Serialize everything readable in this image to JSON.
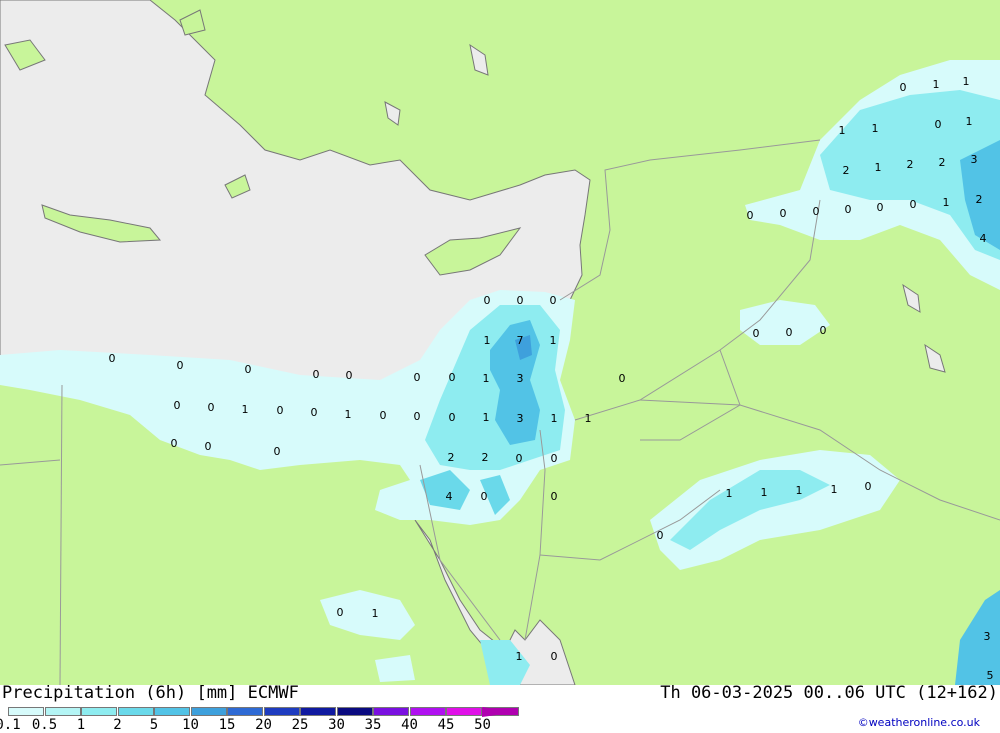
{
  "title": "Precipitation (6h) [mm] ECMWF",
  "valid_time": "Th 06-03-2025 00..06 UTC (12+162)",
  "credit": "©weatheronline.co.uk",
  "colors": {
    "land": "#c8f59a",
    "sea": "#ececec",
    "border": "#999999",
    "coast": "#777777"
  },
  "legend": {
    "labels": [
      "0.1",
      "0.5",
      "1",
      "2",
      "5",
      "10",
      "15",
      "20",
      "25",
      "30",
      "35",
      "40",
      "45",
      "50"
    ],
    "colors": [
      "#d7fbfb",
      "#b4f5f5",
      "#8eecf0",
      "#6ad9ea",
      "#52c3e6",
      "#3ea0dc",
      "#2e6ad4",
      "#1e3cc0",
      "#101aa0",
      "#0a0a80",
      "#7a10e0",
      "#b010f0",
      "#e010e8",
      "#b000b0"
    ]
  },
  "values": [
    {
      "text": "0"
    },
    {
      "text": "0"
    },
    {
      "text": "0"
    },
    {
      "text": "1"
    },
    {
      "text": "7"
    },
    {
      "text": "1"
    },
    {
      "text": "0"
    },
    {
      "text": "0"
    },
    {
      "text": "0"
    },
    {
      "text": "0"
    },
    {
      "text": "0"
    },
    {
      "text": "0"
    },
    {
      "text": "0"
    },
    {
      "text": "1"
    },
    {
      "text": "3"
    },
    {
      "text": "0"
    },
    {
      "text": "0"
    },
    {
      "text": "0"
    },
    {
      "text": "1"
    },
    {
      "text": "0"
    },
    {
      "text": "0"
    },
    {
      "text": "1"
    },
    {
      "text": "0"
    },
    {
      "text": "0"
    },
    {
      "text": "0"
    },
    {
      "text": "1"
    },
    {
      "text": "3"
    },
    {
      "text": "1"
    },
    {
      "text": "1"
    },
    {
      "text": "0"
    },
    {
      "text": "0"
    },
    {
      "text": "0"
    },
    {
      "text": "2"
    },
    {
      "text": "2"
    },
    {
      "text": "0"
    },
    {
      "text": "0"
    },
    {
      "text": "4"
    },
    {
      "text": "0"
    },
    {
      "text": "0"
    },
    {
      "text": "0"
    },
    {
      "text": "1"
    },
    {
      "text": "1"
    },
    {
      "text": "0"
    },
    {
      "text": "0"
    },
    {
      "text": "1"
    },
    {
      "text": "1"
    },
    {
      "text": "1"
    },
    {
      "text": "1"
    },
    {
      "text": "0"
    },
    {
      "text": "1"
    },
    {
      "text": "2"
    },
    {
      "text": "1"
    },
    {
      "text": "2"
    },
    {
      "text": "2"
    },
    {
      "text": "3"
    },
    {
      "text": "0"
    },
    {
      "text": "0"
    },
    {
      "text": "0"
    },
    {
      "text": "0"
    },
    {
      "text": "0"
    },
    {
      "text": "0"
    },
    {
      "text": "1"
    },
    {
      "text": "2"
    },
    {
      "text": "4"
    },
    {
      "text": "0"
    },
    {
      "text": "0"
    },
    {
      "text": "0"
    },
    {
      "text": "1"
    },
    {
      "text": "1"
    },
    {
      "text": "1"
    },
    {
      "text": "1"
    },
    {
      "text": "0"
    },
    {
      "text": "0"
    },
    {
      "text": "3"
    },
    {
      "text": "5"
    }
  ]
}
